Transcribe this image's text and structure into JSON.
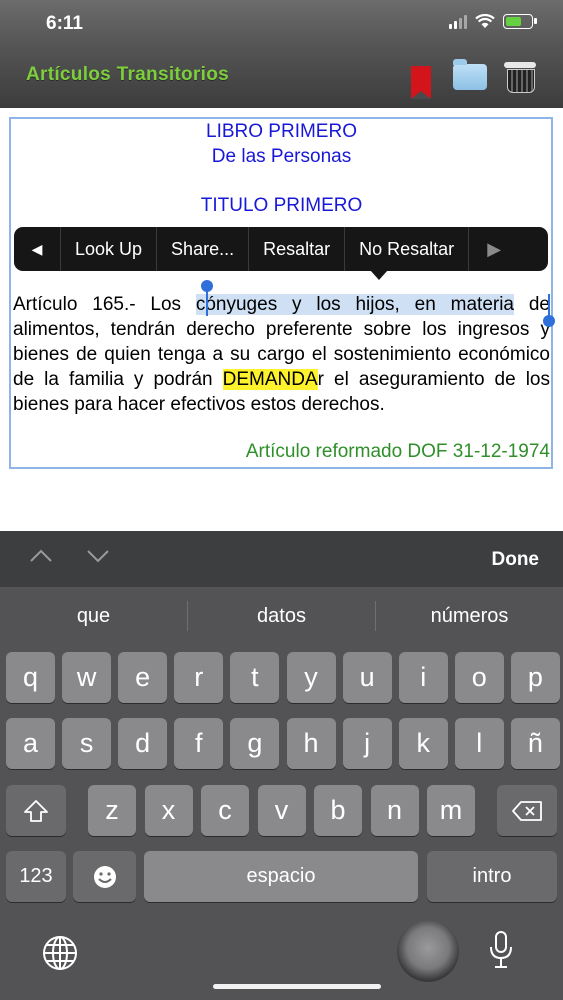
{
  "status": {
    "time": "6:11"
  },
  "nav": {
    "title": "Artículos  Transitorios"
  },
  "document": {
    "book": "LIBRO PRIMERO",
    "book_subtitle": "De las Personas",
    "title": "TITULO PRIMERO",
    "article_start": "Artículo 165.- Los ",
    "article_selected": "cónyuges y los hijos, en materia",
    "article_mid": " de alimentos, tendrán derecho preferente sobre los ingresos y bienes de quien tenga a su cargo el sostenimiento económico de la familia y podrán ",
    "article_highlight": "DEMANDA",
    "article_end": "r el aseguramiento de los bienes para hacer efectivos estos derechos.",
    "reformed": "Artículo reformado DOF 31-12-1974"
  },
  "edit_menu": {
    "items": [
      "Look Up",
      "Share...",
      "Resaltar",
      "No Resaltar"
    ]
  },
  "keyboard": {
    "done": "Done",
    "suggestions": [
      "que",
      "datos",
      "números"
    ],
    "row1": [
      "q",
      "w",
      "e",
      "r",
      "t",
      "y",
      "u",
      "i",
      "o",
      "p"
    ],
    "row2": [
      "a",
      "s",
      "d",
      "f",
      "g",
      "h",
      "j",
      "k",
      "l",
      "ñ"
    ],
    "row3": [
      "z",
      "x",
      "c",
      "v",
      "b",
      "n",
      "m"
    ],
    "numbers": "123",
    "space": "espacio",
    "return": "intro"
  },
  "colors": {
    "nav_title": "#7dce3c",
    "heading_blue": "#1818d6",
    "reformed_green": "#2f8f2a",
    "selection": "#cfe0f4",
    "highlight": "#fdf22b"
  }
}
